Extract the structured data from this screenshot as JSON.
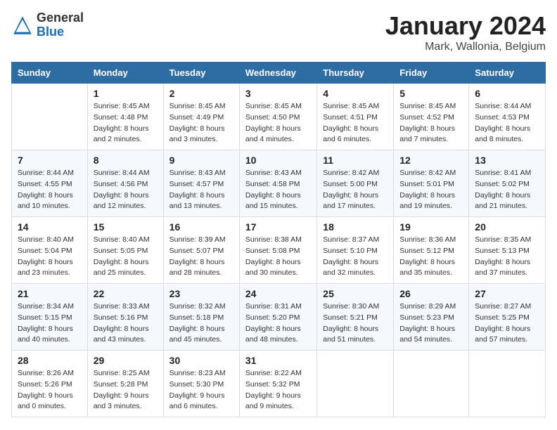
{
  "header": {
    "logo_line1": "General",
    "logo_line2": "Blue",
    "month": "January 2024",
    "location": "Mark, Wallonia, Belgium"
  },
  "days_of_week": [
    "Sunday",
    "Monday",
    "Tuesday",
    "Wednesday",
    "Thursday",
    "Friday",
    "Saturday"
  ],
  "weeks": [
    [
      {
        "day": "",
        "sunrise": "",
        "sunset": "",
        "daylight": ""
      },
      {
        "day": "1",
        "sunrise": "8:45 AM",
        "sunset": "4:48 PM",
        "daylight": "8 hours and 2 minutes."
      },
      {
        "day": "2",
        "sunrise": "8:45 AM",
        "sunset": "4:49 PM",
        "daylight": "8 hours and 3 minutes."
      },
      {
        "day": "3",
        "sunrise": "8:45 AM",
        "sunset": "4:50 PM",
        "daylight": "8 hours and 4 minutes."
      },
      {
        "day": "4",
        "sunrise": "8:45 AM",
        "sunset": "4:51 PM",
        "daylight": "8 hours and 6 minutes."
      },
      {
        "day": "5",
        "sunrise": "8:45 AM",
        "sunset": "4:52 PM",
        "daylight": "8 hours and 7 minutes."
      },
      {
        "day": "6",
        "sunrise": "8:44 AM",
        "sunset": "4:53 PM",
        "daylight": "8 hours and 8 minutes."
      }
    ],
    [
      {
        "day": "7",
        "sunrise": "8:44 AM",
        "sunset": "4:55 PM",
        "daylight": "8 hours and 10 minutes."
      },
      {
        "day": "8",
        "sunrise": "8:44 AM",
        "sunset": "4:56 PM",
        "daylight": "8 hours and 12 minutes."
      },
      {
        "day": "9",
        "sunrise": "8:43 AM",
        "sunset": "4:57 PM",
        "daylight": "8 hours and 13 minutes."
      },
      {
        "day": "10",
        "sunrise": "8:43 AM",
        "sunset": "4:58 PM",
        "daylight": "8 hours and 15 minutes."
      },
      {
        "day": "11",
        "sunrise": "8:42 AM",
        "sunset": "5:00 PM",
        "daylight": "8 hours and 17 minutes."
      },
      {
        "day": "12",
        "sunrise": "8:42 AM",
        "sunset": "5:01 PM",
        "daylight": "8 hours and 19 minutes."
      },
      {
        "day": "13",
        "sunrise": "8:41 AM",
        "sunset": "5:02 PM",
        "daylight": "8 hours and 21 minutes."
      }
    ],
    [
      {
        "day": "14",
        "sunrise": "8:40 AM",
        "sunset": "5:04 PM",
        "daylight": "8 hours and 23 minutes."
      },
      {
        "day": "15",
        "sunrise": "8:40 AM",
        "sunset": "5:05 PM",
        "daylight": "8 hours and 25 minutes."
      },
      {
        "day": "16",
        "sunrise": "8:39 AM",
        "sunset": "5:07 PM",
        "daylight": "8 hours and 28 minutes."
      },
      {
        "day": "17",
        "sunrise": "8:38 AM",
        "sunset": "5:08 PM",
        "daylight": "8 hours and 30 minutes."
      },
      {
        "day": "18",
        "sunrise": "8:37 AM",
        "sunset": "5:10 PM",
        "daylight": "8 hours and 32 minutes."
      },
      {
        "day": "19",
        "sunrise": "8:36 AM",
        "sunset": "5:12 PM",
        "daylight": "8 hours and 35 minutes."
      },
      {
        "day": "20",
        "sunrise": "8:35 AM",
        "sunset": "5:13 PM",
        "daylight": "8 hours and 37 minutes."
      }
    ],
    [
      {
        "day": "21",
        "sunrise": "8:34 AM",
        "sunset": "5:15 PM",
        "daylight": "8 hours and 40 minutes."
      },
      {
        "day": "22",
        "sunrise": "8:33 AM",
        "sunset": "5:16 PM",
        "daylight": "8 hours and 43 minutes."
      },
      {
        "day": "23",
        "sunrise": "8:32 AM",
        "sunset": "5:18 PM",
        "daylight": "8 hours and 45 minutes."
      },
      {
        "day": "24",
        "sunrise": "8:31 AM",
        "sunset": "5:20 PM",
        "daylight": "8 hours and 48 minutes."
      },
      {
        "day": "25",
        "sunrise": "8:30 AM",
        "sunset": "5:21 PM",
        "daylight": "8 hours and 51 minutes."
      },
      {
        "day": "26",
        "sunrise": "8:29 AM",
        "sunset": "5:23 PM",
        "daylight": "8 hours and 54 minutes."
      },
      {
        "day": "27",
        "sunrise": "8:27 AM",
        "sunset": "5:25 PM",
        "daylight": "8 hours and 57 minutes."
      }
    ],
    [
      {
        "day": "28",
        "sunrise": "8:26 AM",
        "sunset": "5:26 PM",
        "daylight": "9 hours and 0 minutes."
      },
      {
        "day": "29",
        "sunrise": "8:25 AM",
        "sunset": "5:28 PM",
        "daylight": "9 hours and 3 minutes."
      },
      {
        "day": "30",
        "sunrise": "8:23 AM",
        "sunset": "5:30 PM",
        "daylight": "9 hours and 6 minutes."
      },
      {
        "day": "31",
        "sunrise": "8:22 AM",
        "sunset": "5:32 PM",
        "daylight": "9 hours and 9 minutes."
      },
      {
        "day": "",
        "sunrise": "",
        "sunset": "",
        "daylight": ""
      },
      {
        "day": "",
        "sunrise": "",
        "sunset": "",
        "daylight": ""
      },
      {
        "day": "",
        "sunrise": "",
        "sunset": "",
        "daylight": ""
      }
    ]
  ]
}
